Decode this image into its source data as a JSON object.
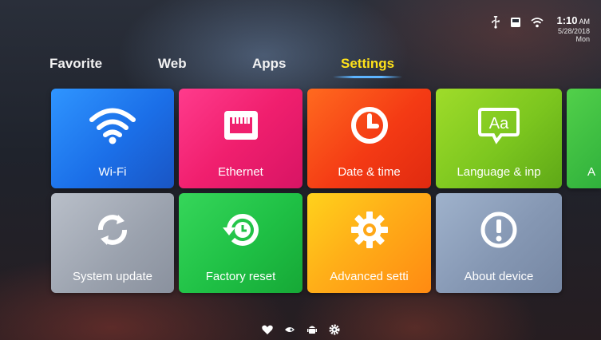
{
  "status_bar": {
    "icons": [
      "usb-icon",
      "sd-card-icon",
      "wifi-icon"
    ],
    "time": "1:10",
    "ampm": "AM",
    "date": "5/28/2018",
    "day": "Mon"
  },
  "tabs": [
    {
      "label": "Favorite",
      "active": false
    },
    {
      "label": "Web",
      "active": false
    },
    {
      "label": "Apps",
      "active": false
    },
    {
      "label": "Settings",
      "active": true
    }
  ],
  "tiles": [
    {
      "label": "Wi-Fi",
      "icon": "wifi-icon",
      "color": "#1f7bf0"
    },
    {
      "label": "Ethernet",
      "icon": "ethernet-icon",
      "color": "#f02574"
    },
    {
      "label": "Date & time",
      "icon": "clock-icon",
      "color": "#f44718"
    },
    {
      "label": "Language & inp",
      "icon": "language-icon",
      "color": "#86cc22"
    },
    {
      "label": "A",
      "icon": "",
      "color": "#36b83e"
    },
    {
      "label": "System update",
      "icon": "refresh-icon",
      "color": "#a3aab5"
    },
    {
      "label": "Factory reset",
      "icon": "restore-icon",
      "color": "#22c44a"
    },
    {
      "label": "Advanced setti",
      "icon": "gear-icon",
      "color": "#ffb018"
    },
    {
      "label": "About device",
      "icon": "info-icon",
      "color": "#8a9cb7"
    }
  ],
  "page_indicator": [
    "heart-icon",
    "rocket-icon",
    "android-icon",
    "gear-icon"
  ]
}
